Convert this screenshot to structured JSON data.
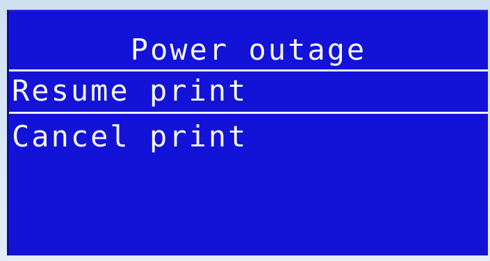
{
  "screen": {
    "title": "Power outage",
    "menu": {
      "items": [
        {
          "label": "Resume print"
        },
        {
          "label": "Cancel print"
        }
      ]
    }
  },
  "colors": {
    "screen_bg": "#1313d8",
    "text": "#f5f6ff",
    "divider": "#eef0ff"
  }
}
